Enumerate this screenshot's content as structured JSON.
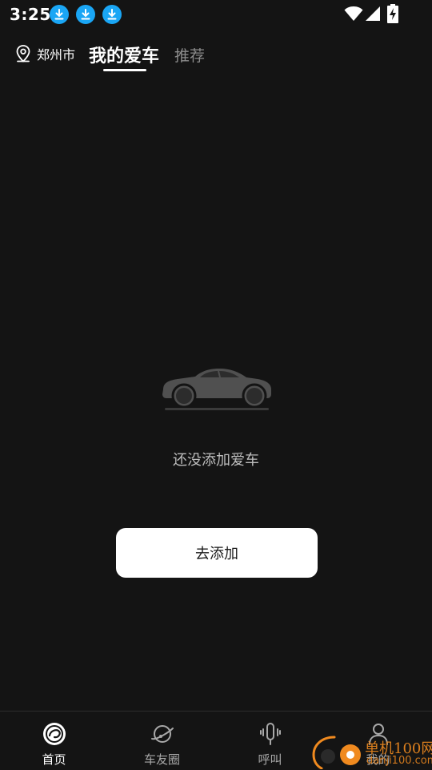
{
  "status_bar": {
    "time": "3:25",
    "notification_icons": [
      "download-icon",
      "download-icon",
      "download-icon"
    ],
    "system_icons": [
      "wifi-icon",
      "signal-icon",
      "battery-charging-icon"
    ]
  },
  "top_bar": {
    "city": "郑州市",
    "tabs": [
      {
        "label": "我的爱车",
        "active": true
      },
      {
        "label": "推荐",
        "active": false
      }
    ]
  },
  "empty_state": {
    "message": "还没添加爱车",
    "button_label": "去添加"
  },
  "bottom_nav": {
    "items": [
      {
        "label": "首页",
        "icon": "home-icon",
        "active": true
      },
      {
        "label": "车友圈",
        "icon": "planet-icon",
        "active": false
      },
      {
        "label": "呼叫",
        "icon": "voice-icon",
        "active": false
      },
      {
        "label": "我的",
        "icon": "profile-icon",
        "active": false
      }
    ]
  },
  "watermark": {
    "line1": "单机100网",
    "line2": "danji100.com"
  },
  "colors": {
    "background": "#141414",
    "accent_download": "#1aa6f5",
    "inactive_text": "#8c8c8c",
    "watermark": "#f08a1f"
  }
}
